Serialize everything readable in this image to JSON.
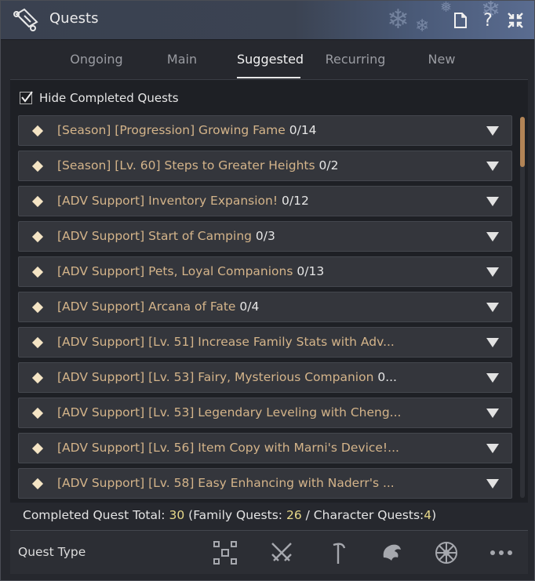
{
  "window": {
    "title": "Quests"
  },
  "tabs": [
    {
      "label": "Ongoing",
      "active": false
    },
    {
      "label": "Main",
      "active": false
    },
    {
      "label": "Suggested",
      "active": true
    },
    {
      "label": "Recurring",
      "active": false
    },
    {
      "label": "New",
      "active": false
    }
  ],
  "filter": {
    "hide_completed_label": "Hide Completed Quests",
    "hide_completed_checked": true
  },
  "quests": [
    {
      "title": "[Season] [Progression] Growing Fame",
      "progress": "0/14"
    },
    {
      "title": "[Season] [Lv. 60] Steps to Greater Heights",
      "progress": "0/2"
    },
    {
      "title": "[ADV Support] Inventory Expansion!",
      "progress": "0/12"
    },
    {
      "title": "[ADV Support] Start of Camping",
      "progress": "0/3"
    },
    {
      "title": "[ADV Support] Pets, Loyal Companions",
      "progress": "0/13"
    },
    {
      "title": "[ADV Support] Arcana of Fate",
      "progress": "0/4"
    },
    {
      "title": "[ADV Support] [Lv. 51] Increase Family Stats with Adv...",
      "progress": ""
    },
    {
      "title": "[ADV Support] [Lv. 53] Fairy, Mysterious Companion",
      "progress": "0..."
    },
    {
      "title": "[ADV Support] [Lv. 53] Legendary Leveling with Cheng...",
      "progress": ""
    },
    {
      "title": "[ADV Support] [Lv. 56] Item Copy with Marni's Device!...",
      "progress": ""
    },
    {
      "title": "[ADV Support] [Lv. 58] Easy Enhancing with Naderr's ...",
      "progress": ""
    }
  ],
  "totals": {
    "label": "Completed Quest Total:",
    "total": "30",
    "family_label": "(Family Quests:",
    "family": "26",
    "separator": "/",
    "character_label": "Character Quests:",
    "character": "4",
    "close": ")"
  },
  "footer": {
    "quest_type_label": "Quest Type",
    "icons": [
      "grid-icon",
      "crossed-swords-icon",
      "sickle-icon",
      "fish-icon",
      "wheel-icon",
      "more-icon"
    ]
  },
  "colors": {
    "accent_quest_title": "#d4b48a",
    "number_highlight": "#e8d98a",
    "scroll_thumb": "#b28456"
  }
}
